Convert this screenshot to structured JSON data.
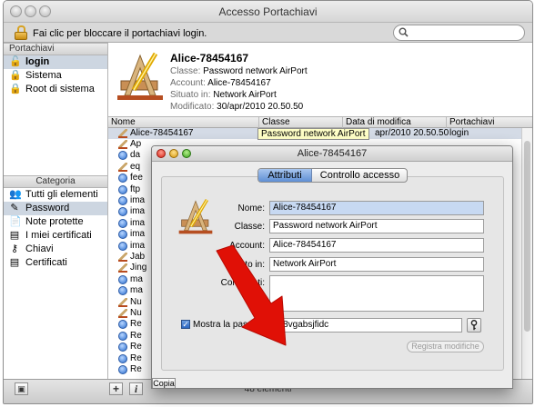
{
  "window": {
    "title": "Accesso Portachiavi"
  },
  "toolbar": {
    "lock_text": "Fai clic per bloccare il portachiavi login.",
    "search_value": ""
  },
  "sidebar": {
    "keychains_header": "Portachiavi",
    "keychains": [
      "login",
      "Sistema",
      "Root di sistema"
    ],
    "category_header": "Categoria",
    "categories": [
      "Tutti gli elementi",
      "Password",
      "Note protette",
      "I miei certificati",
      "Chiavi",
      "Certificati"
    ]
  },
  "info": {
    "name": "Alice-78454167",
    "class_label": "Classe:",
    "class_value": "Password network AirPort",
    "account_label": "Account:",
    "account_value": "Alice-78454167",
    "location_label": "Situato in:",
    "location_value": "Network AirPort",
    "modified_label": "Modificato:",
    "modified_value": "30/apr/2010 20.50.50"
  },
  "list": {
    "columns": [
      "Nome",
      "Classe",
      "Data di modifica",
      "Portachiavi"
    ],
    "first_row": {
      "name": "Alice-78454167",
      "date": "apr/2010 20.50.50",
      "keychain": "login"
    },
    "rows": [
      "Ap",
      "da",
      "eq",
      "fee",
      "ftp",
      "ima",
      "ima",
      "ima",
      "ima",
      "ima",
      "Jab",
      "Jing",
      "ma",
      "ma",
      "Nu",
      "Nu",
      "Re",
      "Re",
      "Re",
      "Re",
      "Re"
    ],
    "tooltip": "Password network AirPort"
  },
  "bottom": {
    "count": "48 elementi",
    "add": "+",
    "info": "i"
  },
  "dialog": {
    "title": "Alice-78454167",
    "tab_attributes": "Attributi",
    "tab_access": "Controllo accesso",
    "name_label": "Nome:",
    "name_value": "Alice-78454167",
    "class_label": "Classe:",
    "class_value": "Password network AirPort",
    "account_label": "Account:",
    "account_value": "Alice-78454167",
    "location_label": "Situato in:",
    "location_value": "Network AirPort",
    "comments_label": "Commenti:",
    "show_password_label": "Mostra la password:",
    "password_value": "988vgabsjfidc",
    "save_label": "Registra modifiche",
    "copy_label": "Copia"
  }
}
